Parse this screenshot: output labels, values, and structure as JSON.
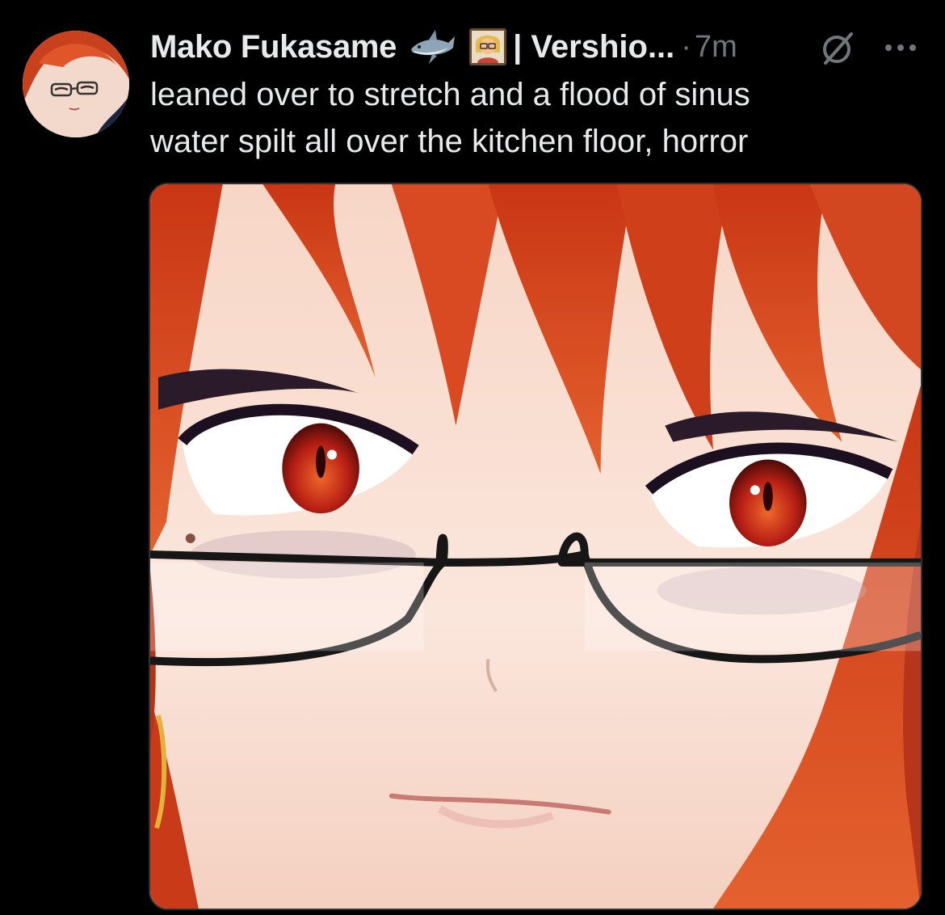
{
  "post": {
    "author_name": "Mako Fukasame",
    "name_suffix": "| Vershio...",
    "separator": "·",
    "timestamp": "7m",
    "text_lines": [
      "leaned over to stretch and a flood of sinus",
      "water spilt all over the kitchen floor, horror"
    ],
    "badges": [
      "shark-emoji",
      "teacher-emoji"
    ],
    "icons": {
      "grok": "grok-icon",
      "more": "more-options-icon"
    }
  },
  "colors": {
    "background": "#000000",
    "primary_text": "#e7e9ea",
    "secondary_text": "#71767b",
    "hair": "#d8431e",
    "eye": "#c7261a"
  }
}
